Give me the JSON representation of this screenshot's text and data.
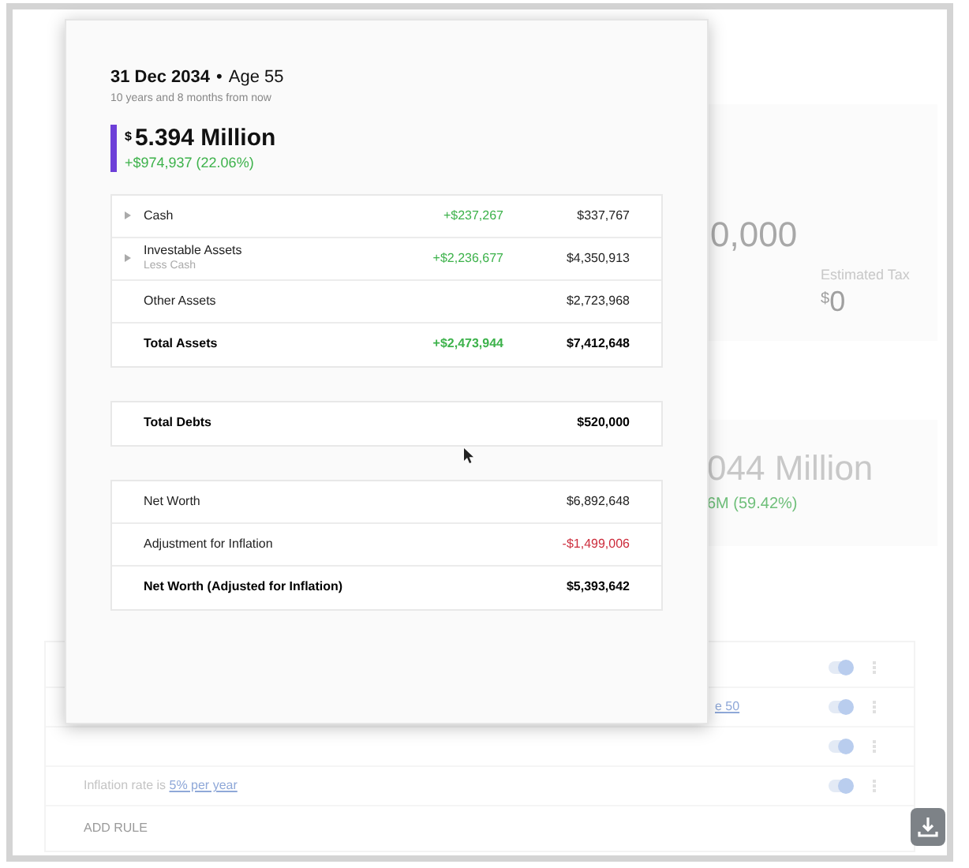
{
  "background": {
    "summary_value": "0,000",
    "tax_label": "Estimated Tax",
    "tax_currency": "$",
    "tax_value": "0",
    "net_worth": "044 Million",
    "net_change": "6M (59.42%)",
    "rules": [
      {
        "on": true
      },
      {
        "link": "e 50",
        "on": true
      },
      {
        "on": true
      },
      {
        "text": "Inflation rate is ",
        "link": "5% per year",
        "on": true
      }
    ],
    "add_rule": "ADD RULE"
  },
  "popup": {
    "date": "31 Dec 2034",
    "separator": "•",
    "age": "Age 55",
    "subtitle": "10 years and 8 months from now",
    "currency": "$",
    "amount": "5.394 Million",
    "change": "+$974,937 (22.06%)",
    "assets": [
      {
        "label": "Cash",
        "change": "+$237,267",
        "value": "$337,767",
        "expandable": true,
        "total": false
      },
      {
        "label": "Investable Assets",
        "sublabel": "Less Cash",
        "change": "+$2,236,677",
        "value": "$4,350,913",
        "expandable": true,
        "total": false
      },
      {
        "label": "Other Assets",
        "value": "$2,723,968",
        "expandable": false,
        "total": false
      },
      {
        "label": "Total Assets",
        "change": "+$2,473,944",
        "value": "$7,412,648",
        "expandable": false,
        "total": true
      }
    ],
    "debts": [
      {
        "label": "Total Debts",
        "value": "$520,000",
        "total": true,
        "negative": false
      }
    ],
    "net": [
      {
        "label": "Net Worth",
        "value": "$6,892,648",
        "total": false,
        "negative": false
      },
      {
        "label": "Adjustment for Inflation",
        "value": "-$1,499,006",
        "total": false,
        "negative": true
      },
      {
        "label": "Net Worth (Adjusted for Inflation)",
        "value": "$5,393,642",
        "total": true,
        "negative": false
      }
    ]
  }
}
